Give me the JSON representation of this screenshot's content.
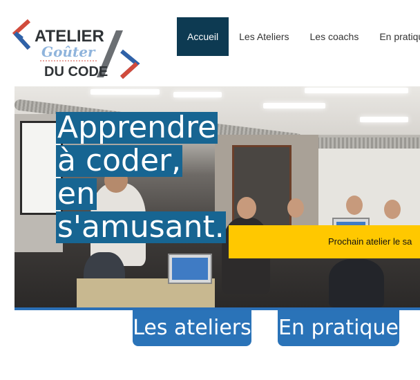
{
  "logo": {
    "line1": "ATELIER",
    "line2": "Goûter",
    "line3": "DU CODE",
    "colors": {
      "blue": "#2f62a8",
      "red": "#d14b3c",
      "dark": "#2f3336",
      "lightblue": "#8fb4dc"
    }
  },
  "nav": {
    "items": [
      {
        "label": "Accueil",
        "active": true
      },
      {
        "label": "Les Ateliers",
        "active": false
      },
      {
        "label": "Les coachs",
        "active": false
      },
      {
        "label": "En pratique",
        "active": false
      }
    ]
  },
  "hero": {
    "headline_lines": [
      "Apprendre",
      "à coder,",
      "en",
      "s'amusant."
    ],
    "banner": "Prochain atelier le sa"
  },
  "buttons": {
    "ateliers": "Les ateliers",
    "pratique": "En pratique"
  },
  "colors": {
    "nav_active_bg": "#0d3a52",
    "headline_bg": "#176592",
    "banner_bg": "#ffc800",
    "button_bg": "#2a73b8"
  }
}
